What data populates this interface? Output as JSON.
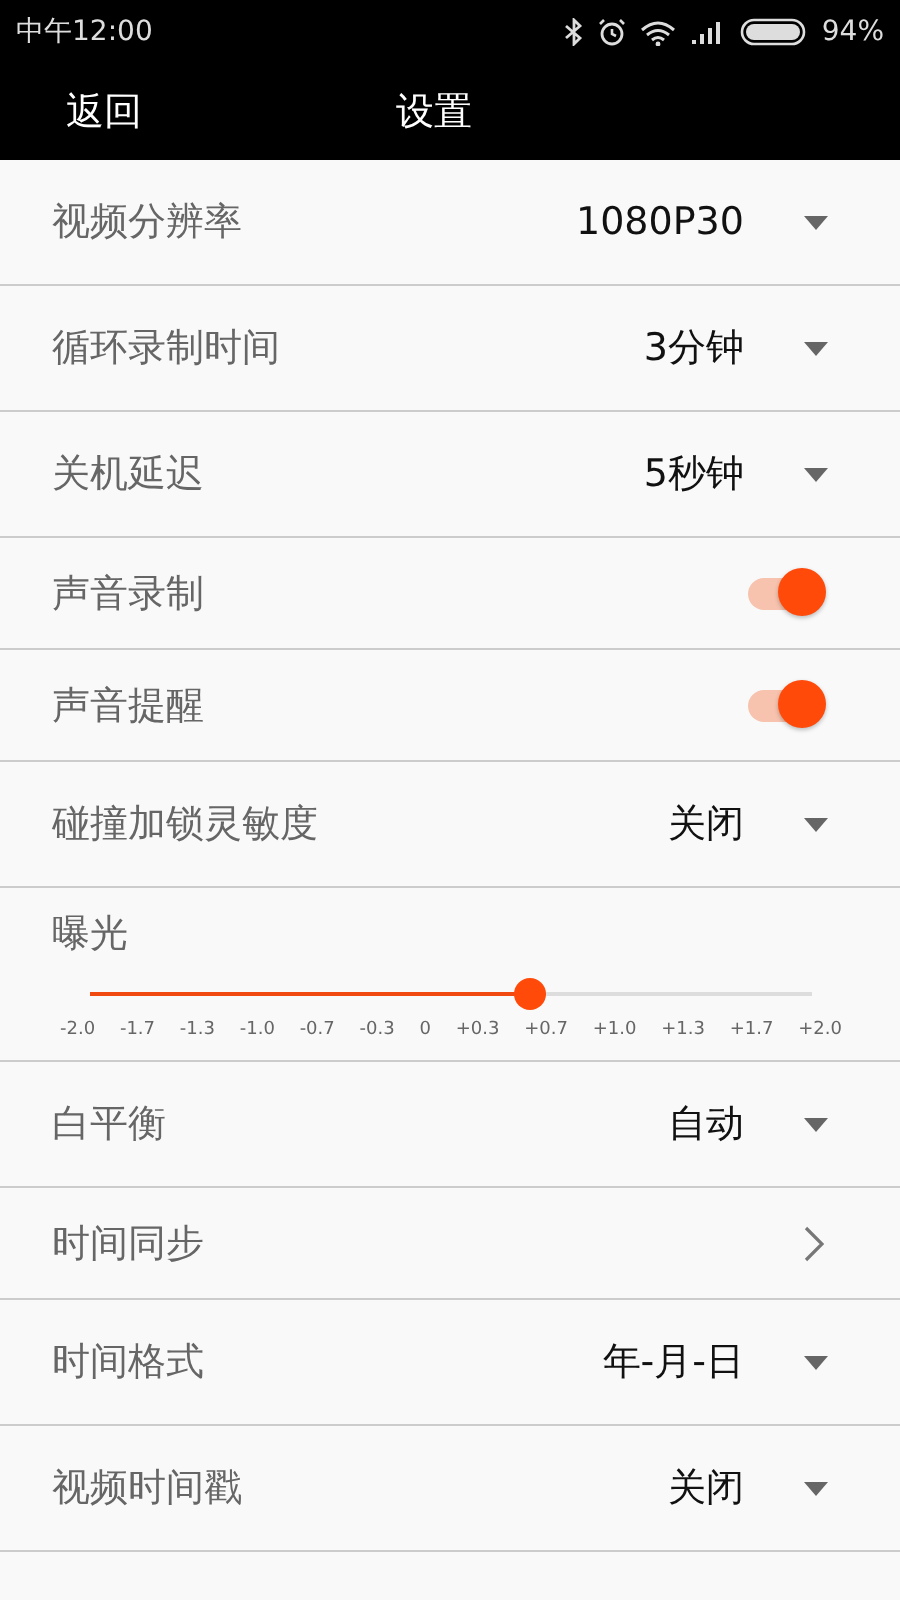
{
  "status_bar": {
    "time": "中午12:00",
    "battery": "94%"
  },
  "header": {
    "back": "返回",
    "title": "设置"
  },
  "settings": [
    {
      "kind": "select",
      "label": "视频分辨率",
      "value": "1080P30"
    },
    {
      "kind": "select",
      "label": "循环录制时间",
      "value": "3分钟"
    },
    {
      "kind": "select",
      "label": "关机延迟",
      "value": "5秒钟"
    },
    {
      "kind": "toggle",
      "label": "声音录制",
      "on": true
    },
    {
      "kind": "toggle",
      "label": "声音提醒",
      "on": true
    },
    {
      "kind": "select",
      "label": "碰撞加锁灵敏度",
      "value": "关闭"
    },
    {
      "kind": "slider",
      "label": "曝光",
      "level": 0.583,
      "ticks": [
        "-2.0",
        "-1.7",
        "-1.3",
        "-1.0",
        "-0.7",
        "-0.3",
        "0",
        "+0.3",
        "+0.7",
        "+1.0",
        "+1.3",
        "+1.7",
        "+2.0"
      ]
    },
    {
      "kind": "select",
      "label": "白平衡",
      "value": "自动"
    },
    {
      "kind": "link",
      "label": "时间同步"
    },
    {
      "kind": "select",
      "label": "时间格式",
      "value": "年-月-日"
    },
    {
      "kind": "select",
      "label": "视频时间戳",
      "value": "关闭"
    }
  ]
}
